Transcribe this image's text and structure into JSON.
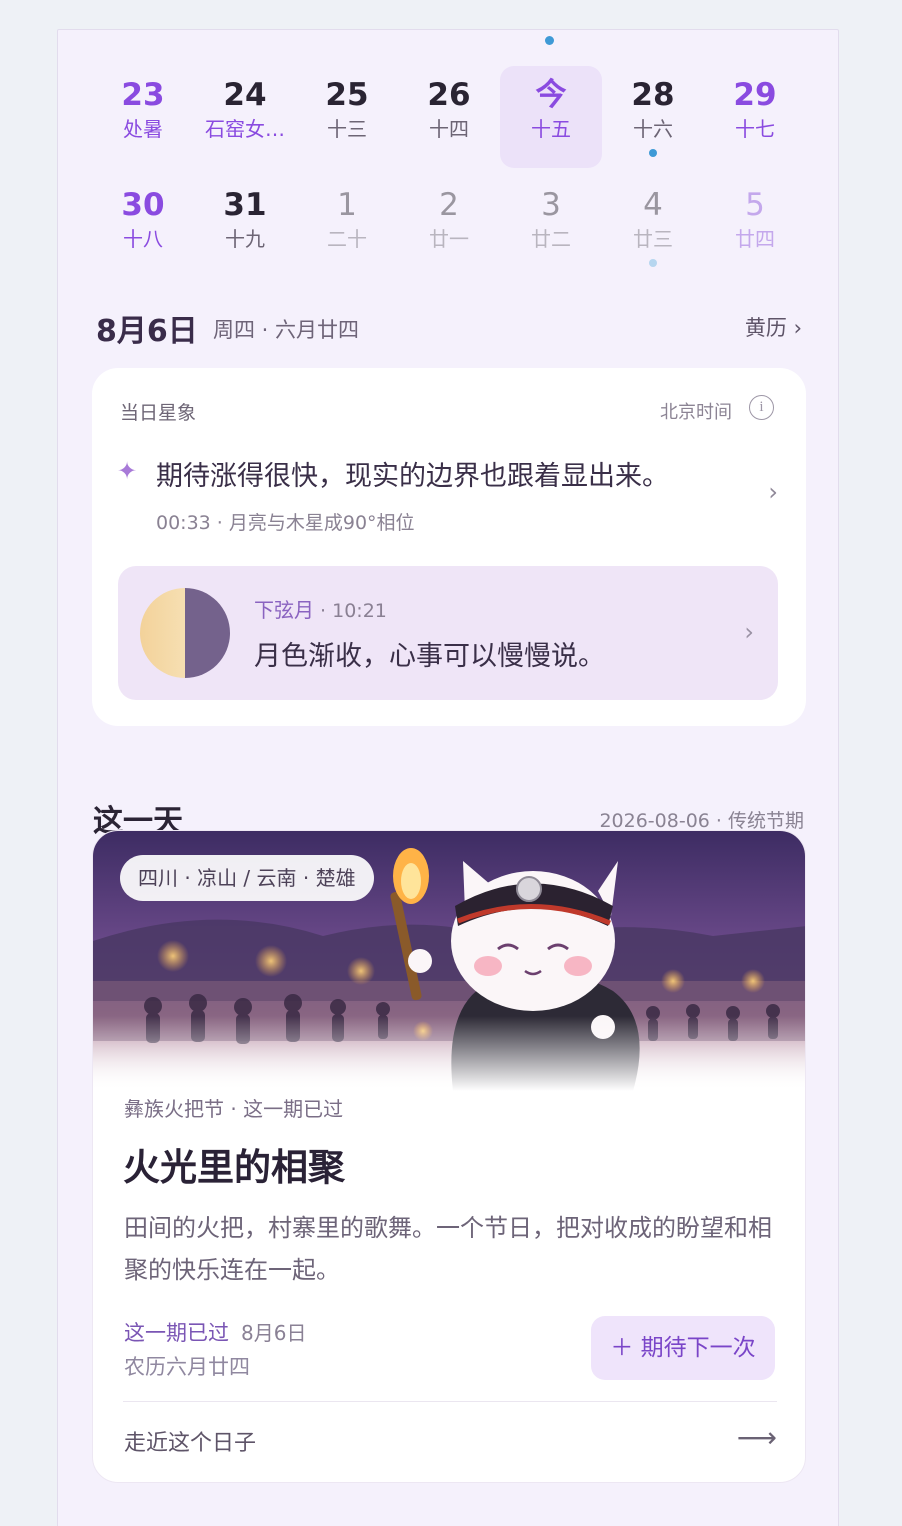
{
  "calendar": {
    "row1": [
      {
        "day": "23",
        "lunar": "处暑",
        "kind": "weekend"
      },
      {
        "day": "24",
        "lunar": "石窑女…",
        "kind": "festival"
      },
      {
        "day": "25",
        "lunar": "十三",
        "kind": "normal"
      },
      {
        "day": "26",
        "lunar": "十四",
        "kind": "normal"
      },
      {
        "day": "今",
        "lunar": "十五",
        "kind": "today"
      },
      {
        "day": "28",
        "lunar": "十六",
        "kind": "normal",
        "dot": true
      },
      {
        "day": "29",
        "lunar": "十七",
        "kind": "weekend"
      }
    ],
    "row2": [
      {
        "day": "30",
        "lunar": "十八",
        "kind": "weekend"
      },
      {
        "day": "31",
        "lunar": "十九",
        "kind": "normal"
      },
      {
        "day": "1",
        "lunar": "二十",
        "kind": "future"
      },
      {
        "day": "2",
        "lunar": "廿一",
        "kind": "future"
      },
      {
        "day": "3",
        "lunar": "廿二",
        "kind": "future"
      },
      {
        "day": "4",
        "lunar": "廿三",
        "kind": "future",
        "dot": true
      },
      {
        "day": "5",
        "lunar": "廿四",
        "kind": "future weekend"
      }
    ]
  },
  "date_header": {
    "date": "8月6日",
    "sub": "周四 · 六月廿四",
    "almanac_link": "黄历 ›"
  },
  "stars": {
    "title": "当日星象",
    "timezone": "北京时间",
    "info_symbol": "i",
    "sparkle": "✦",
    "quote": "期待涨得很快，现实的边界也跟着显出来。",
    "meta": "00:33 · 月亮与木星成90°相位",
    "chevron": "›",
    "moon": {
      "phase": "下弦月",
      "time": " · 10:21",
      "text": "月色渐收，心事可以慢慢说。",
      "chevron": "›"
    }
  },
  "this_day": {
    "title": "这一天",
    "meta": "2026-08-06 · 传统节期"
  },
  "festival": {
    "region": "四川 · 凉山 / 云南 · 楚雄",
    "kicker": "彝族火把节 · 这一期已过",
    "title": "火光里的相聚",
    "description": "田间的火把，村寨里的歌舞。一个节日，把对收成的盼望和相聚的快乐连在一起。",
    "status": "这一期已过",
    "status_date": "8月6日",
    "lunar": "农历六月廿四",
    "button": "＋ 期待下一次",
    "approach": "走近这个日子",
    "arrow": "⟶"
  },
  "colors": {
    "accent": "#8a4be0",
    "dot": "#3e9ad6",
    "background": "#f5f1fc"
  }
}
